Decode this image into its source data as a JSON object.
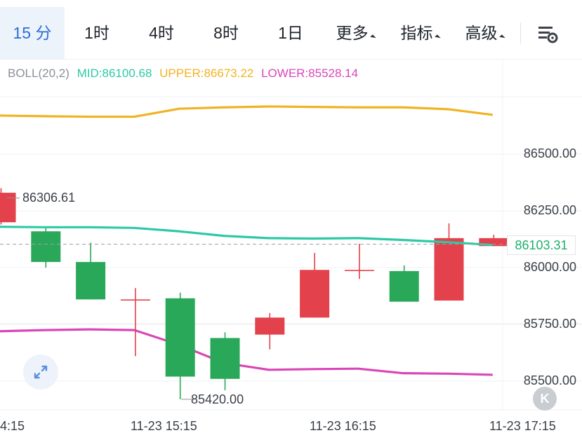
{
  "tabs": [
    {
      "label": "15 分",
      "active": true
    },
    {
      "label": "1时"
    },
    {
      "label": "4时"
    },
    {
      "label": "8时"
    },
    {
      "label": "1日"
    },
    {
      "label": "更多",
      "dropdown": true
    },
    {
      "label": "指标",
      "dropdown": true
    },
    {
      "label": "高级",
      "dropdown": true
    }
  ],
  "settings_icon": "chart-settings-icon",
  "indicator": {
    "name": "BOLL(20,2)",
    "mid": "MID:86100.68",
    "upper": "UPPER:86673.22",
    "lower": "LOWER:85528.14",
    "colors": {
      "name": "#8c9099",
      "mid": "#2cc9a6",
      "upper": "#f0b323",
      "lower": "#d946b8"
    }
  },
  "price_tag": "86103.31",
  "high_label": "86306.61",
  "low_label": "85420.00",
  "expand_icon": "expand-arrows-icon",
  "k_button": "K",
  "chart_data": {
    "type": "candlestick",
    "y_axis": {
      "ticks": [
        "86500.00",
        "86250.00",
        "86000.00",
        "85750.00",
        "85500.00"
      ],
      "values": [
        86500,
        86250,
        86000,
        85750,
        85500
      ]
    },
    "x_axis": {
      "ticks": [
        "4:15",
        "11-23 15:15",
        "11-23 16:15",
        "11-23 17:15"
      ]
    },
    "current_price": 86103.31,
    "candles": [
      {
        "open": 86200,
        "close": 86330,
        "high": 86350,
        "low": 86190
      },
      {
        "open": 86160,
        "close": 86025,
        "high": 86180,
        "low": 86000
      },
      {
        "open": 86025,
        "close": 85860,
        "high": 86110,
        "low": 85860
      },
      {
        "open": 85860,
        "close": 85860,
        "high": 85910,
        "low": 85610
      },
      {
        "open": 85865,
        "close": 85520,
        "high": 85890,
        "low": 85420
      },
      {
        "open": 85690,
        "close": 85510,
        "high": 85715,
        "low": 85460
      },
      {
        "open": 85705,
        "close": 85780,
        "high": 85800,
        "low": 85640
      },
      {
        "open": 85780,
        "close": 85990,
        "high": 86065,
        "low": 85780
      },
      {
        "open": 85990,
        "close": 85990,
        "high": 86105,
        "low": 85950
      },
      {
        "open": 85985,
        "close": 85850,
        "high": 86010,
        "low": 85850
      },
      {
        "open": 85855,
        "close": 86130,
        "high": 86195,
        "low": 85855
      },
      {
        "open": 86095,
        "close": 86130,
        "high": 86145,
        "low": 86095
      }
    ],
    "up_color": "#e3414b",
    "down_color": "#2aa85a",
    "boll_upper": [
      86670,
      86667,
      86665,
      86665,
      86700,
      86706,
      86710,
      86708,
      86706,
      86706,
      86698,
      86673
    ],
    "boll_mid": [
      86180,
      86178,
      86178,
      86175,
      86160,
      86140,
      86130,
      86128,
      86130,
      86122,
      86112,
      86100
    ],
    "boll_lower": [
      85720,
      85725,
      85728,
      85725,
      85660,
      85580,
      85550,
      85553,
      85555,
      85535,
      85533,
      85528
    ]
  }
}
